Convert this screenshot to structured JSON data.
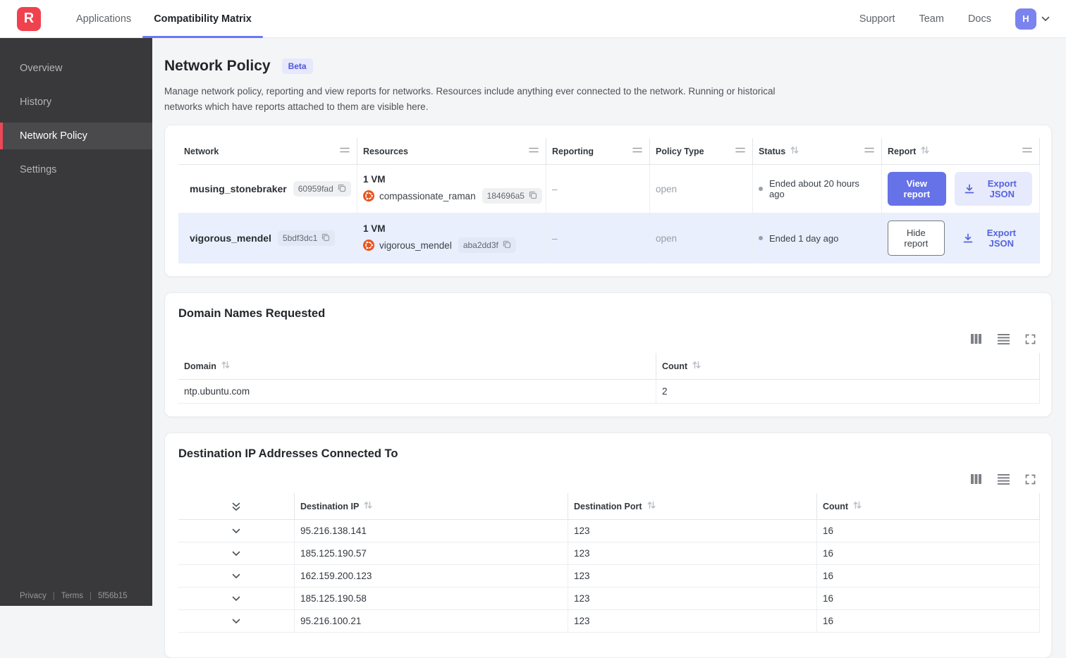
{
  "colors": {
    "accent_indigo": "#6672e8",
    "accent_indigo_light": "#e7eafc",
    "brand_red": "#f0414f",
    "sidebar_active_red": "#ee4757",
    "ubuntu_orange": "#e95420",
    "selected_row": "#e9effc",
    "beta_badge_bg": "#e6e8fb",
    "beta_badge_text": "#4c58d8"
  },
  "topnav": {
    "logo_letter": "R",
    "tabs": [
      {
        "label": "Applications",
        "active": false
      },
      {
        "label": "Compatibility Matrix",
        "active": true
      }
    ],
    "links": [
      {
        "label": "Support"
      },
      {
        "label": "Team"
      },
      {
        "label": "Docs"
      }
    ],
    "avatar_initial": "H"
  },
  "sidebar": {
    "items": [
      {
        "label": "Overview",
        "active": false
      },
      {
        "label": "History",
        "active": false
      },
      {
        "label": "Network Policy",
        "active": true
      },
      {
        "label": "Settings",
        "active": false
      }
    ],
    "footer": {
      "privacy": "Privacy",
      "terms": "Terms",
      "version": "5f56b15"
    }
  },
  "page": {
    "title": "Network Policy",
    "beta_badge": "Beta",
    "description": "Manage network policy, reporting and view reports for networks. Resources include anything ever connected to the network. Running or historical networks which have reports attached to them are visible here."
  },
  "networks_table": {
    "columns": {
      "network": "Network",
      "resources": "Resources",
      "reporting": "Reporting",
      "policy_type": "Policy Type",
      "status": "Status",
      "report": "Report"
    },
    "rows": [
      {
        "network": "musing_stonebraker",
        "network_hash": "60959fad",
        "vm_count": "1 VM",
        "resource_name": "compassionate_raman",
        "resource_hash": "184696a5",
        "reporting": "–",
        "policy_type": "open",
        "status": "Ended about 20 hours ago",
        "report_button": "View report",
        "export_button": "Export JSON",
        "selected": false
      },
      {
        "network": "vigorous_mendel",
        "network_hash": "5bdf3dc1",
        "vm_count": "1 VM",
        "resource_name": "vigorous_mendel",
        "resource_hash": "aba2dd3f",
        "reporting": "–",
        "policy_type": "open",
        "status": "Ended 1 day ago",
        "report_button": "Hide report",
        "export_button": "Export JSON",
        "selected": true
      }
    ]
  },
  "domains_section": {
    "title": "Domain Names Requested",
    "toolbar_icons": [
      "columns-icon",
      "rows-density-icon",
      "fullscreen-icon"
    ],
    "columns": {
      "domain": "Domain",
      "count": "Count"
    },
    "rows": [
      {
        "domain": "ntp.ubuntu.com",
        "count": "2"
      }
    ]
  },
  "destinations_section": {
    "title": "Destination IP Addresses Connected To",
    "toolbar_icons": [
      "columns-icon",
      "rows-density-icon",
      "fullscreen-icon"
    ],
    "columns": {
      "ip": "Destination IP",
      "port": "Destination Port",
      "count": "Count"
    },
    "rows": [
      {
        "ip": "95.216.138.141",
        "port": "123",
        "count": "16"
      },
      {
        "ip": "185.125.190.57",
        "port": "123",
        "count": "16"
      },
      {
        "ip": "162.159.200.123",
        "port": "123",
        "count": "16"
      },
      {
        "ip": "185.125.190.58",
        "port": "123",
        "count": "16"
      },
      {
        "ip": "95.216.100.21",
        "port": "123",
        "count": "16"
      }
    ]
  }
}
